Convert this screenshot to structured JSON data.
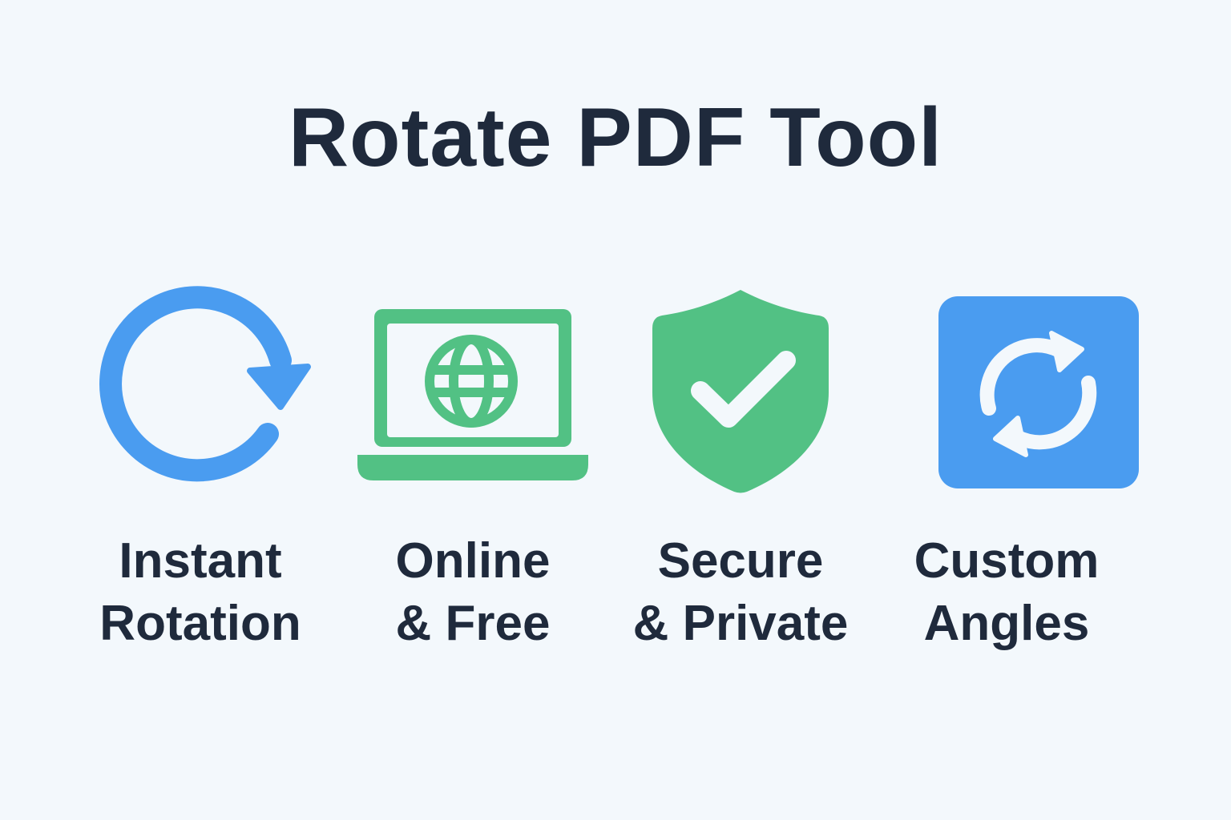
{
  "title": "Rotate PDF Tool",
  "colors": {
    "blue": "#4a9cf0",
    "green": "#52c184",
    "text": "#1f2a3c",
    "background": "#f3f8fc"
  },
  "features": [
    {
      "icon": "rotate-clockwise-icon",
      "line1": "Instant",
      "line2": "Rotation"
    },
    {
      "icon": "laptop-globe-icon",
      "line1": "Online",
      "line2": "& Free"
    },
    {
      "icon": "shield-check-icon",
      "line1": "Secure",
      "line2": "& Private"
    },
    {
      "icon": "refresh-arrows-icon",
      "line1": "Custom",
      "line2": "Angles"
    }
  ]
}
